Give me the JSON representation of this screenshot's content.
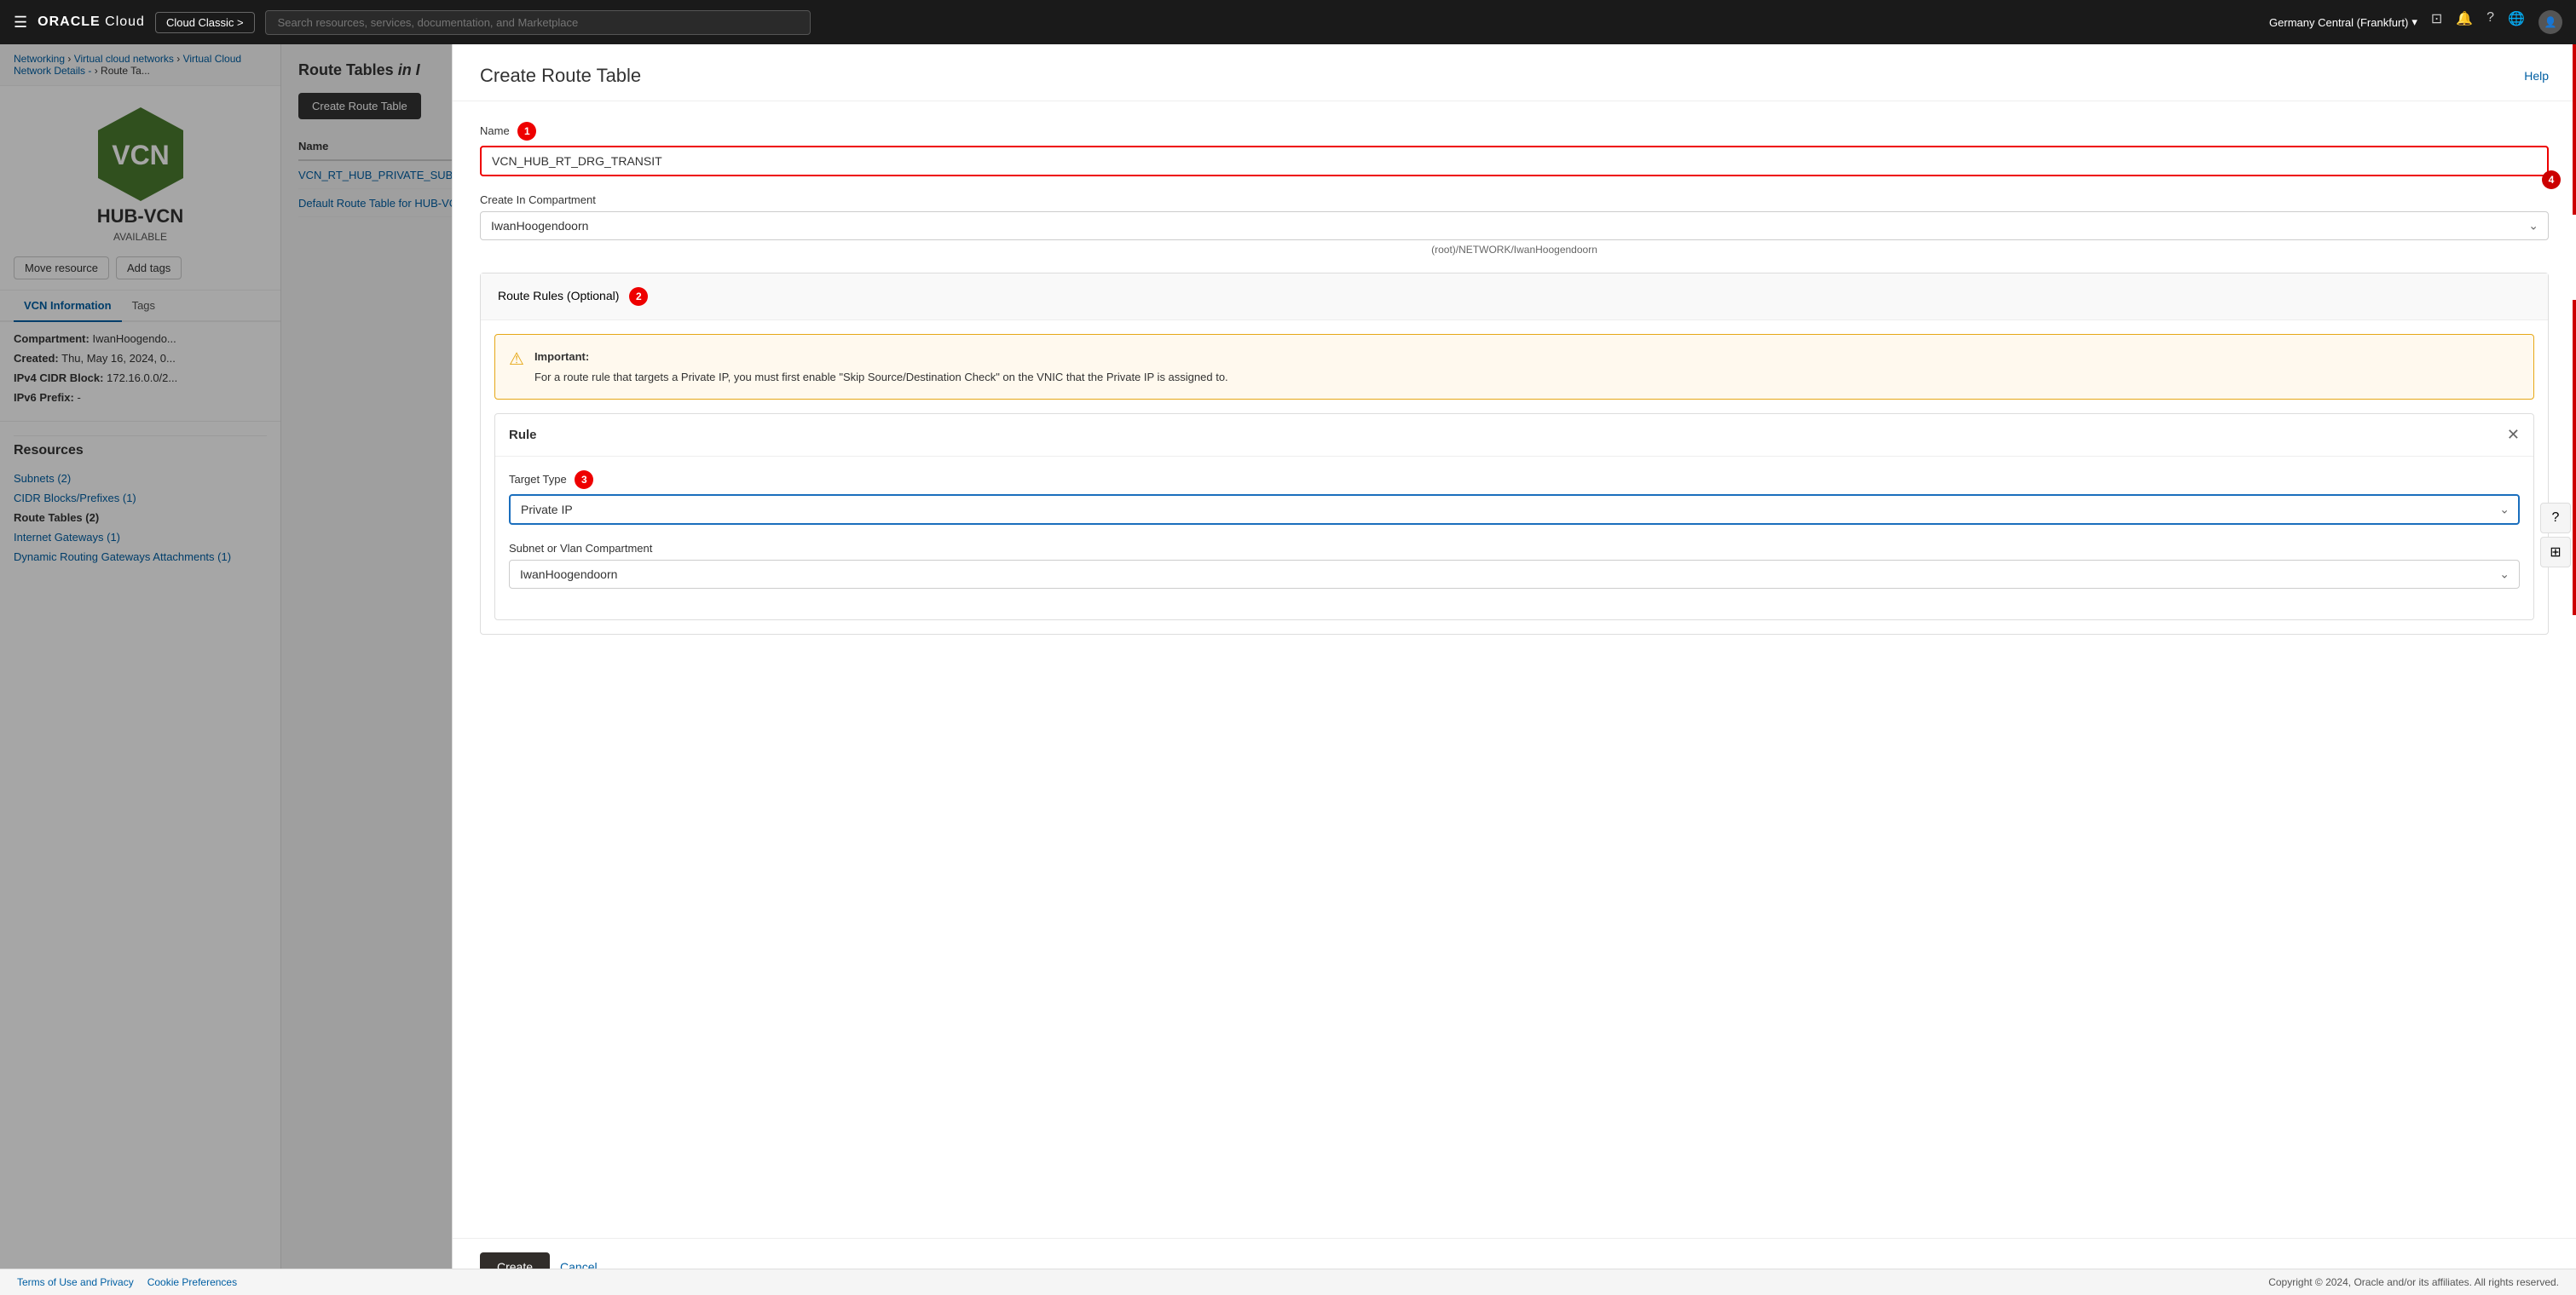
{
  "topNav": {
    "hamburger": "☰",
    "logoText": "ORACLE",
    "logoCloud": " Cloud",
    "cloudClassic": "Cloud Classic >",
    "searchPlaceholder": "Search resources, services, documentation, and Marketplace",
    "region": "Germany Central (Frankfurt)",
    "regionIcon": "▾",
    "icons": [
      "□",
      "🔔",
      "?",
      "🌐",
      "👤"
    ]
  },
  "breadcrumb": {
    "networking": "Networking",
    "sep1": "›",
    "vcn": "Virtual cloud networks",
    "sep2": "›",
    "vcnDetails": "Virtual Cloud Network Details -",
    "sep3": "›",
    "routeTables": "Route Ta..."
  },
  "leftPanel": {
    "vcnName": "HUB-VCN",
    "vcnStatus": "AVAILABLE",
    "buttons": {
      "moveResource": "Move resource",
      "addTags": "Add tags"
    },
    "tabs": {
      "vcnInfo": "VCN Information",
      "tags": "Tags"
    },
    "info": {
      "compartmentLabel": "Compartment:",
      "compartmentValue": "IwanHoogendo...",
      "createdLabel": "Created:",
      "createdValue": "Thu, May 16, 2024, 0...",
      "ipv4Label": "IPv4 CIDR Block:",
      "ipv4Value": "172.16.0.0/2...",
      "ipv6Label": "IPv6 Prefix:",
      "ipv6Value": "-"
    },
    "resources": {
      "title": "Resources",
      "items": [
        {
          "label": "Subnets (2)",
          "active": false
        },
        {
          "label": "CIDR Blocks/Prefixes (1)",
          "active": false
        },
        {
          "label": "Route Tables (2)",
          "active": true
        },
        {
          "label": "Internet Gateways (1)",
          "active": false
        },
        {
          "label": "Dynamic Routing Gateways Attachments (1)",
          "active": false
        }
      ]
    }
  },
  "mainContent": {
    "sectionTitle": "Route Tables in I",
    "sectionTitleItalic": "I",
    "createButton": "Create Route Table",
    "tableHeader": "Name",
    "rows": [
      {
        "link": "VCN_RT_HUB_PRIVATE_SUBNE..."
      },
      {
        "link": "Default Route Table for HUB-VC..."
      }
    ]
  },
  "panel": {
    "title": "Create Route Table",
    "helpLabel": "Help",
    "nameLabel": "Name",
    "nameValue": "VCN_HUB_RT_DRG_TRANSIT",
    "nameBadge": "1",
    "compartmentLabel": "Create In Compartment",
    "compartmentValue": "IwanHoogendoorn",
    "compartmentPath": "(root)/NETWORK/IwanHoogendoorn",
    "routeRulesTitle": "Route Rules (Optional)",
    "routeRulesBadge": "2",
    "important": {
      "title": "Important:",
      "text": "For a route rule that targets a Private IP, you must first enable \"Skip Source/Destination Check\" on the VNIC that the Private IP is assigned to."
    },
    "rule": {
      "title": "Rule",
      "closeIcon": "✕",
      "targetTypeLabel": "Target Type",
      "targetTypeBadge": "3",
      "targetTypeValue": "Private IP",
      "subnetCompartmentLabel": "Subnet or Vlan Compartment",
      "subnetCompartmentValue": "IwanHoogendoorn"
    },
    "footer": {
      "createLabel": "Create",
      "cancelLabel": "Cancel"
    },
    "scrollBadge": "4"
  },
  "bottomBar": {
    "termsLink": "Terms of Use and Privacy",
    "cookiesLink": "Cookie Preferences",
    "copyright": "Copyright © 2024, Oracle and/or its affiliates. All rights reserved."
  }
}
